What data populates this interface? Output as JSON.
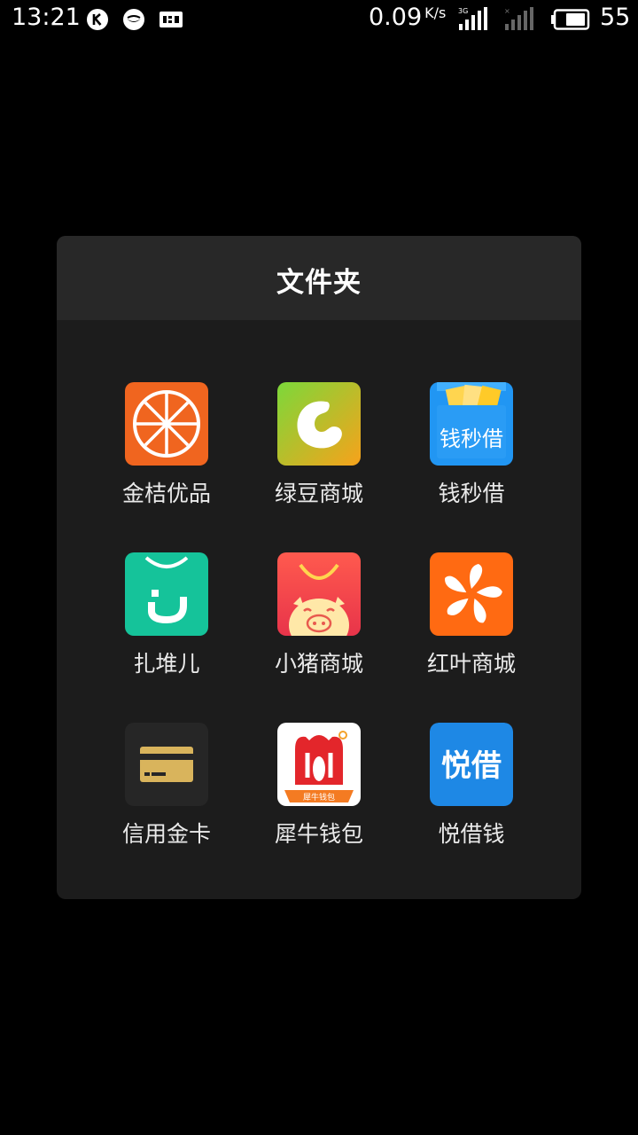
{
  "status_bar": {
    "time": "13:21",
    "net_speed": "0.09",
    "net_speed_unit": "K/s",
    "network_type": "3G",
    "battery": "55",
    "icons": [
      "k-app-icon",
      "smile-app-icon",
      "sim-card-icon",
      "signal-3g-icon",
      "signal-no-sim-icon",
      "battery-icon"
    ]
  },
  "folder": {
    "title": "文件夹",
    "apps": [
      {
        "label": "金桔优品",
        "icon": "orange-slice-icon"
      },
      {
        "label": "绿豆商城",
        "icon": "green-bean-icon"
      },
      {
        "label": "钱秒借",
        "icon": "wallet-cards-icon",
        "icon_text": "钱秒借"
      },
      {
        "label": "扎堆儿",
        "icon": "shopping-bag-face-icon"
      },
      {
        "label": "小猪商城",
        "icon": "pig-bag-icon"
      },
      {
        "label": "红叶商城",
        "icon": "pinwheel-leaf-icon"
      },
      {
        "label": "信用金卡",
        "icon": "gold-card-icon"
      },
      {
        "label": "犀牛钱包",
        "icon": "rhino-icon",
        "icon_text": "犀牛钱包"
      },
      {
        "label": "悦借钱",
        "icon": "yue-jie-icon",
        "icon_text": "悦借"
      }
    ]
  },
  "colors": {
    "background": "#000000",
    "folder_bg": "#1c1c1c",
    "folder_header_bg": "#282828"
  }
}
